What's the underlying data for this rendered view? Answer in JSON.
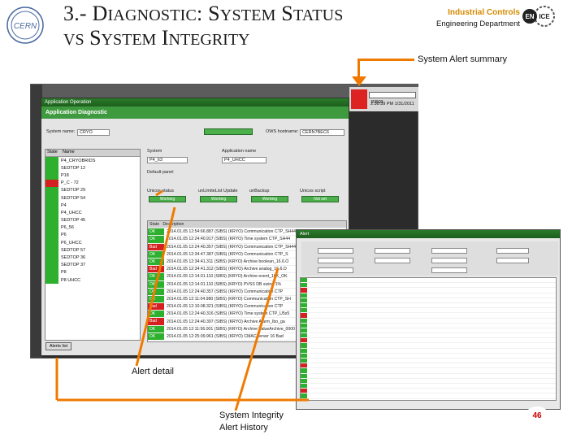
{
  "slide": {
    "title_line1_prefix": "3.- D",
    "title_line1_sc": "iagnostic",
    "title_line1_mid": ": S",
    "title_line1_sc2": "ystem",
    "title_line1_sp": " S",
    "title_line1_sc3": "tatus",
    "title_line2_sc0": "vs",
    "title_line2_mid": " S",
    "title_line2_sc": "ystem",
    "title_line2_sp": " I",
    "title_line2_sc2": "ntegrity",
    "org_name": "Industrial Controls",
    "department": "Engineering Department",
    "page_number": "46"
  },
  "callouts": {
    "alert_summary": "System Alert  summary",
    "alert_detail": "Alert detail",
    "integrity_line1": "System  Integrity",
    "integrity_line2": "Alert History"
  },
  "colors": {
    "arrow": "#f07a00",
    "ok": "#2db02d",
    "bad": "#d42020",
    "brand": "#d68a00"
  },
  "app": {
    "title": "Application Diagnostic",
    "search_value": "P3503",
    "clock": "2:30:39 PM  1/31/2011",
    "alert_list_button": "Alerts list",
    "default_panel": "Default panel",
    "system_label": "System",
    "system_value": "P4_63",
    "app_label": "Application name",
    "app_value": "P4_UHCC",
    "system_name_label": "System name:",
    "system_name_value": "CRYO",
    "ows_label": "OWS hostname:",
    "ows_value": "CERN7BEC6",
    "status_options": [
      "Unicos status",
      "unLimiteList Update",
      "unBackup",
      "Unicos script"
    ],
    "status_values": [
      "Working",
      "Working",
      "Working",
      "Not set"
    ],
    "list_items": [
      {
        "name": "P4_CRYOBRIDS",
        "status": "ok"
      },
      {
        "name": "SEDTOP 12",
        "status": "ok"
      },
      {
        "name": "P18",
        "status": "ok"
      },
      {
        "name": "P_C - 72",
        "status": "bad"
      },
      {
        "name": "SEDTOP 29",
        "status": "ok"
      },
      {
        "name": "SEDTOP 54",
        "status": "ok"
      },
      {
        "name": "P4",
        "status": "ok"
      },
      {
        "name": "P4_UHCC",
        "status": "ok"
      },
      {
        "name": "SEDTOP 45",
        "status": "ok"
      },
      {
        "name": "P6_56",
        "status": "ok"
      },
      {
        "name": "P6",
        "status": "ok"
      },
      {
        "name": "P6_UHCC",
        "status": "ok"
      },
      {
        "name": "SEDTOP 57",
        "status": "ok"
      },
      {
        "name": "SEDTOP 36",
        "status": "ok"
      },
      {
        "name": "SEDTOP 37",
        "status": "ok"
      },
      {
        "name": "P8",
        "status": "ok"
      },
      {
        "name": "P8 UHCC",
        "status": "ok"
      }
    ],
    "alarm_rows": [
      {
        "state": "OK",
        "text": "2014.01.05 12:54:66.887 (SIBS) (KRYO) Communication CTP_SH44_OK"
      },
      {
        "state": "OK",
        "text": "2014.01.05 12:24:40.917 (SIBS) (KRYO) Time system CTP_SH44"
      },
      {
        "state": "Bad",
        "text": "2014.01.05 12:24:40.357 (SIBS) (KRYO) Communication CTP_SH44"
      },
      {
        "state": "OK",
        "text": "2014.01.05 12:34:47.387 (SIBS) (KRYO) Communication CTP_S"
      },
      {
        "state": "OK",
        "text": "2014.01.05 12:34:41.311 (SIBS) (KRYO) Archive boolean_16.6.O"
      },
      {
        "state": "Bad",
        "text": "2014.01.05 12:34:41.312 (SIBS) (KRYO) Archive analog_16.6.O"
      },
      {
        "state": "OK",
        "text": "2014.01.05 12:14:01.110 (SIBS) (KRYO) Archive event_10K_OK"
      },
      {
        "state": "OK",
        "text": "2014.01.05 12:14:01.110 (SIBS) (KRYO) PVSS DB sizing 1%"
      },
      {
        "state": "OK",
        "text": "2014.01.05 12:24:40.357 (SIBS) (KRYO) Communication CTP"
      },
      {
        "state": "OK",
        "text": "2014.01.05 12:11:04.980 (SIBS) (KRYO) Communication CTP_SH"
      },
      {
        "state": "Bad",
        "text": "2014.01.05 12:10:08.321 (SIBS) (KRYO) Communication CTP"
      },
      {
        "state": "OK",
        "text": "2014.01.05 12:24:40.316 (SIBS) (KRYO) Time system CTP_U5x5"
      },
      {
        "state": "Bad",
        "text": "2014.01.05 12:24:40.397 (SIBS) (KRYO) Archive Alarm_Ibo_ga"
      },
      {
        "state": "OK",
        "text": "2014.01.05 12:11:56.001 (SIBS) (KRYO) Archive ValueArchive_0000"
      },
      {
        "state": "OK",
        "text": "2014.01.05 12:25:09.961 (SIBS) (KRYO) CMACServer 16 Bad"
      }
    ]
  }
}
